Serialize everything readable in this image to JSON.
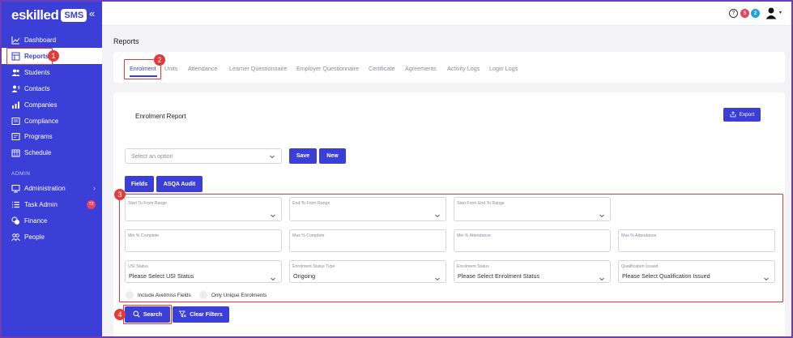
{
  "brand": {
    "name": "eskilled",
    "badge": "SMS",
    "collapse": "«"
  },
  "sidebar": {
    "items": [
      {
        "label": "Dashboard",
        "icon": "chart-line-icon"
      },
      {
        "label": "Reports",
        "icon": "report-icon"
      },
      {
        "label": "Students",
        "icon": "students-icon"
      },
      {
        "label": "Contacts",
        "icon": "contacts-icon"
      },
      {
        "label": "Companies",
        "icon": "companies-icon"
      },
      {
        "label": "Compliance",
        "icon": "compliance-icon"
      },
      {
        "label": "Programs",
        "icon": "programs-icon"
      },
      {
        "label": "Schedule",
        "icon": "schedule-icon"
      }
    ],
    "admin_label": "ADMIN",
    "admin_items": [
      {
        "label": "Administration",
        "icon": "monitor-icon",
        "chevron": "›"
      },
      {
        "label": "Task Admin",
        "icon": "list-icon",
        "badge": "72"
      },
      {
        "label": "Finance",
        "icon": "coins-icon"
      },
      {
        "label": "People",
        "icon": "people-icon"
      }
    ]
  },
  "topbar": {
    "help": "?",
    "notif_red": "5",
    "notif_blue": "2",
    "caret": "▾"
  },
  "page": {
    "title": "Reports"
  },
  "tabs": [
    "Enrolment",
    "Units",
    "Attendance",
    "Learner Questionnaire",
    "Employer Questionnaire",
    "Certificate",
    "Agreements",
    "Activity Logs",
    "Login Logs"
  ],
  "report": {
    "title": "Enrolment Report",
    "export_label": "Export",
    "select_placeholder": "Select an option",
    "save_label": "Save",
    "new_label": "New",
    "fields_label": "Fields",
    "asqa_label": "ASQA Audit"
  },
  "filters": {
    "row1": [
      {
        "label": "Start To From Range",
        "value": ""
      },
      {
        "label": "End To From Range",
        "value": ""
      },
      {
        "label": "Start From End To Range",
        "value": ""
      }
    ],
    "row2": [
      {
        "label": "Min % Complete",
        "value": ""
      },
      {
        "label": "Max % Complete",
        "value": ""
      },
      {
        "label": "Min % Attendance",
        "value": ""
      },
      {
        "label": "Max % Attendance",
        "value": ""
      }
    ],
    "row3": [
      {
        "label": "USI Status",
        "value": "Please Select USI Status"
      },
      {
        "label": "Enrolment Status Type",
        "value": "Ongoing"
      },
      {
        "label": "Enrolment Status",
        "value": "Please Select Enrolment Status"
      },
      {
        "label": "Qualification Issued",
        "value": "Please Select Qualification Issued"
      }
    ],
    "check_avetmiss": "Include Avetmiss Fields",
    "check_unique": "Only Unique Enrolments"
  },
  "actions": {
    "search_label": "Search",
    "clear_label": "Clear Filters"
  },
  "markers": [
    "1",
    "2",
    "3",
    "4"
  ],
  "colors": {
    "primary": "#3b3fd8",
    "highlight": "#e33a3a",
    "frame": "#6a3fb5"
  }
}
